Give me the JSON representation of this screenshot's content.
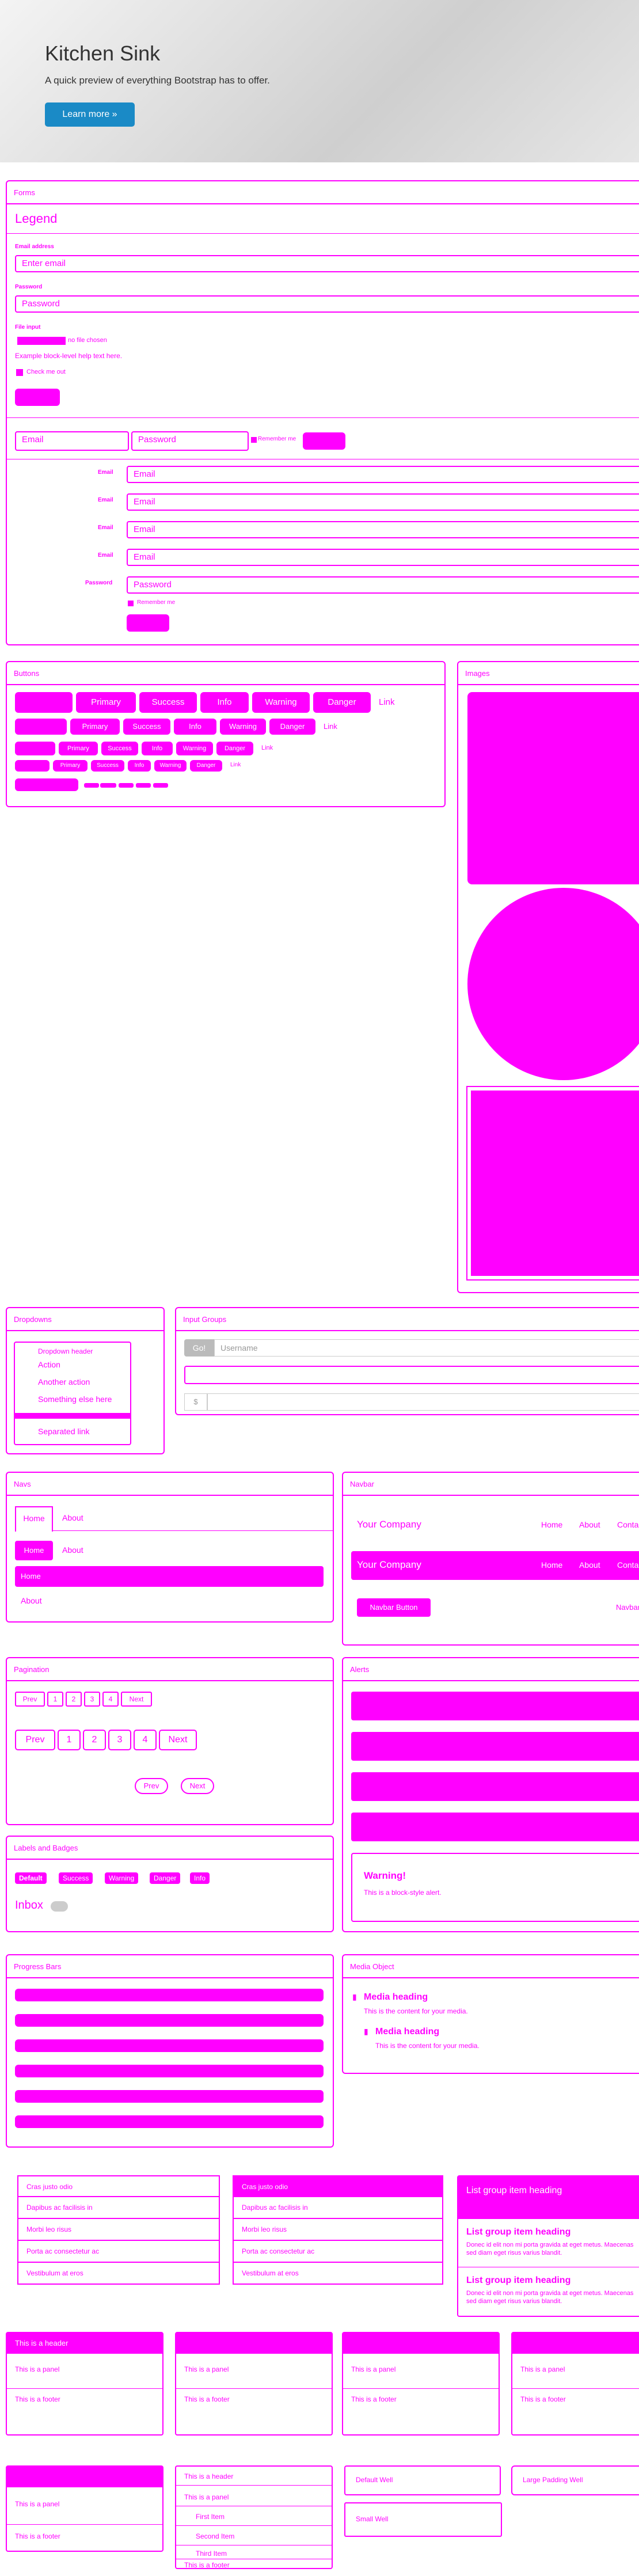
{
  "jumbotron": {
    "title": "Kitchen Sink",
    "subtitle": "A quick preview of everything Bootstrap has to offer.",
    "button": "Learn more »"
  },
  "forms": {
    "title": "Forms",
    "legend": "Legend",
    "email_label": "Email address",
    "email_placeholder": "Enter email",
    "password_label": "Password",
    "password_placeholder": "Password",
    "file_label": "File input",
    "file_text": "no file chosen",
    "help": "Example block-level help text here.",
    "check": "Check me out",
    "inline_email": "Email",
    "inline_password": "Password",
    "inline_remember": "Remember me",
    "h_label": "Email",
    "h_email": "Email",
    "h_password_label": "Password",
    "h_password": "Password",
    "h_remember": "Remember me"
  },
  "buttons": {
    "title": "Buttons",
    "labels": [
      "Primary",
      "Success",
      "Info",
      "Warning",
      "Danger"
    ],
    "link": "Link"
  },
  "images": {
    "title": "Images"
  },
  "dropdowns": {
    "title": "Dropdowns",
    "header": "Dropdown header",
    "items": [
      "Action",
      "Another action",
      "Something else here"
    ],
    "separated": "Separated link"
  },
  "input_groups": {
    "title": "Input Groups",
    "go": "Go!",
    "username": "Username",
    "dollar": "$"
  },
  "navs": {
    "title": "Navs",
    "tabs": [
      "Home",
      "About"
    ],
    "pills": [
      "Home",
      "About"
    ],
    "stacked": [
      "Home",
      "About"
    ]
  },
  "navbar": {
    "title": "Navbar",
    "brand": "Your Company",
    "links": [
      "Home",
      "About",
      "Contact"
    ],
    "inverse_brand": "Your Company",
    "button": "Navbar Button",
    "right": "Navbar"
  },
  "pagination": {
    "title": "Pagination",
    "pages": [
      "Prev",
      "1",
      "2",
      "3",
      "4",
      "Next"
    ],
    "pager": [
      "Prev",
      "Next"
    ]
  },
  "alerts": {
    "title": "Alerts",
    "warning_title": "Warning!",
    "warning_text": "This is a block-style alert."
  },
  "labels": {
    "title": "Labels and Badges",
    "items": [
      "Default",
      "Success",
      "Warning",
      "Danger",
      "Info"
    ],
    "inbox": "Inbox"
  },
  "progress": {
    "title": "Progress Bars",
    "values": [
      100,
      100,
      100,
      100,
      100,
      100
    ]
  },
  "media": {
    "title": "Media Object",
    "heading": "Media heading",
    "text": "This is the content for your media.",
    "nested_heading": "Media heading",
    "nested_text": "This is the content for your media."
  },
  "lists": {
    "plain": [
      "Cras justo odio",
      "Dapibus ac facilisis in",
      "Morbi leo risus",
      "Porta ac consectetur ac",
      "Vestibulum at eros"
    ],
    "active": [
      "Cras justo odio",
      "Dapibus ac facilisis in",
      "Morbi leo risus",
      "Porta ac consectetur ac",
      "Vestibulum at eros"
    ],
    "linked_head": "List group item heading",
    "linked": [
      {
        "h": "List group item heading",
        "t": "Donec id elit non mi porta gravida at eget metus. Maecenas sed diam eget risus varius blandit."
      },
      {
        "h": "List group item heading",
        "t": "Donec id elit non mi porta gravida at eget metus. Maecenas sed diam eget risus varius blandit."
      }
    ]
  },
  "panels": {
    "heading": "This is a header",
    "body": "This is a panel",
    "footer": "This is a footer",
    "group_items": [
      "First Item",
      "Second Item",
      "Third Item"
    ]
  },
  "wells": {
    "default": "Default Well",
    "large": "Large Padding Well",
    "small": "Small Well"
  }
}
